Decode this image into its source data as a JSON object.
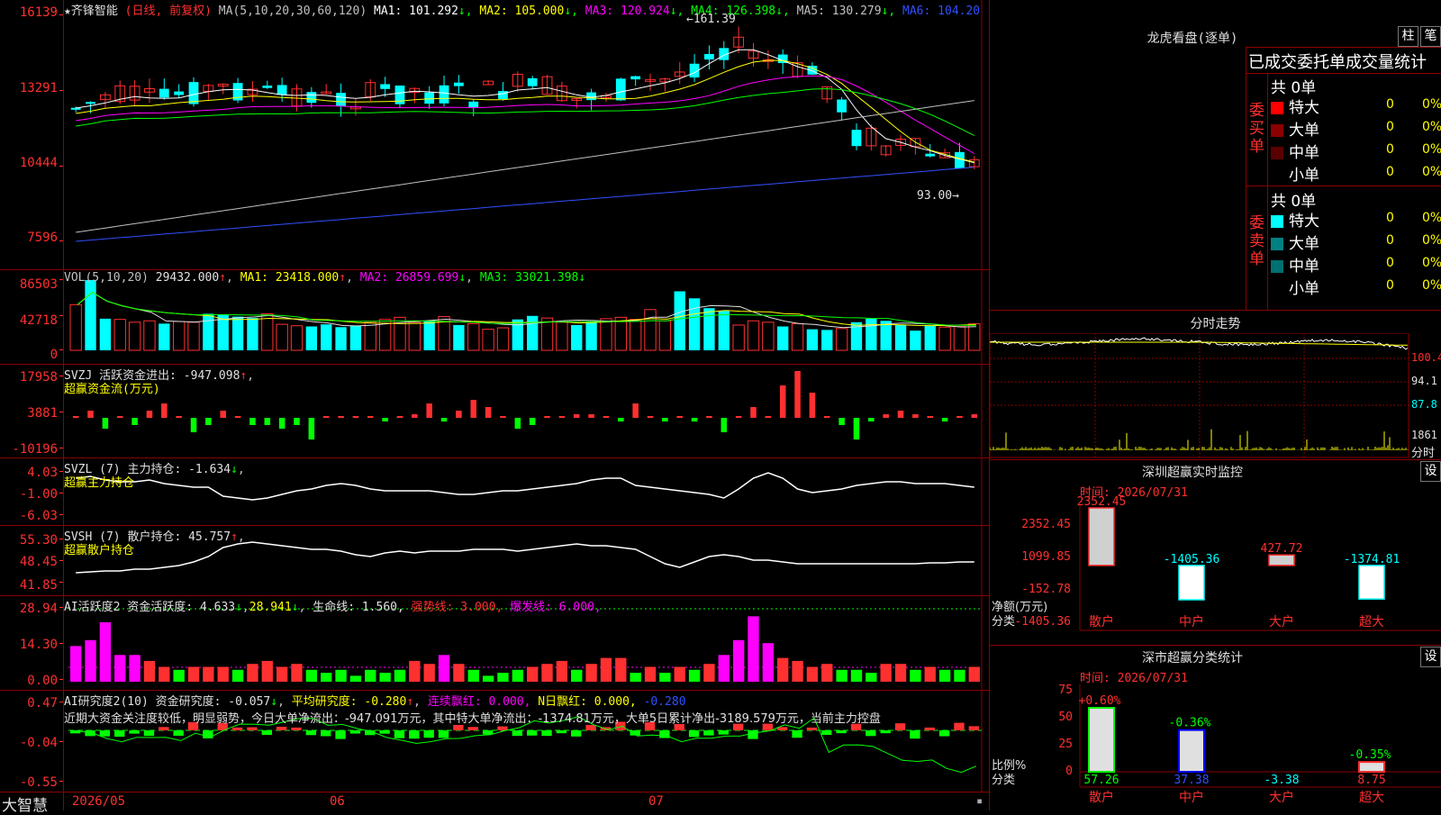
{
  "stock": {
    "name": "★齐锋智能",
    "mode": "(日线, 前复权)",
    "ma_label": "MA(5,10,20,30,60,120)",
    "ma": [
      {
        "text": "MA1: 101.292",
        "arrow": "↓",
        "color": "#ffffff"
      },
      {
        "text": "MA2: 105.000",
        "arrow": "↓",
        "color": "#ffff00"
      },
      {
        "text": "MA3: 120.924",
        "arrow": "↓",
        "color": "#ff00ff"
      },
      {
        "text": "MA4: 126.398",
        "arrow": "↓",
        "color": "#00ff00"
      },
      {
        "text": "MA5: 130.279",
        "arrow": "↓",
        "color": "#c0c0c0"
      },
      {
        "text": "MA6: 104.20",
        "arrow": "",
        "color": "#3050ff"
      }
    ],
    "y_labels": [
      "16139",
      "13291",
      "10444",
      "7596"
    ],
    "high_mark": "161.39",
    "low_mark": "93.00"
  },
  "colors": {
    "up": "#ff3030",
    "down": "#00ffff",
    "green": "#00ff00",
    "magenta": "#ff00ff",
    "grid": "#8b0000"
  },
  "vol": {
    "header": "VOL(5,10,20)",
    "value": "29432.000",
    "ma1": "MA1: 23418.000",
    "ma2": "MA2: 26859.699",
    "ma3": "MA3: 33021.398",
    "y_labels": [
      "86503",
      "42718",
      "0"
    ],
    "values": [
      65,
      100,
      45,
      44,
      40,
      42,
      38,
      41,
      40,
      52,
      51,
      48,
      46,
      52,
      37,
      35,
      34,
      37,
      33,
      35,
      40,
      44,
      47,
      40,
      42,
      48,
      36,
      38,
      30,
      32,
      44,
      49,
      46,
      40,
      36,
      41,
      45,
      47,
      44,
      58,
      42,
      84,
      74,
      60,
      56,
      36,
      42,
      40,
      34,
      38,
      30,
      29,
      31,
      40,
      45,
      42,
      36,
      28,
      35,
      33,
      34,
      38,
      38,
      36,
      29
    ]
  },
  "svzj": {
    "header": "SVZJ  活跃资金进出: -947.098",
    "sub": "超赢资金流(万元)",
    "y_labels": [
      "17958",
      "3881",
      "-10196"
    ],
    "values": [
      0,
      2,
      -3,
      0,
      -2,
      2,
      4,
      0,
      -4,
      -2,
      2,
      0,
      -2,
      -2,
      -3,
      -2,
      -6,
      0,
      0,
      0,
      0,
      -1,
      0,
      1,
      4,
      -1,
      2,
      5,
      3,
      0,
      -3,
      -2,
      0,
      0,
      1,
      1,
      0,
      -1,
      4,
      0,
      -1,
      0,
      -1,
      0,
      -4,
      0,
      3,
      0,
      9,
      13,
      7,
      0,
      -2,
      -6,
      -1,
      1,
      2,
      1,
      0,
      -1,
      0,
      1,
      0,
      1,
      -1,
      0,
      -1,
      0,
      0,
      0
    ]
  },
  "svzl": {
    "header": "SVZL (7) 主力持仓: -1.634",
    "sub": "超赢主力持仓",
    "y_labels": [
      "4.03",
      "-1.00",
      "-6.03"
    ]
  },
  "svsh": {
    "header": "SVSH (7) 散户持仓: 45.757",
    "sub": "超赢散户持仓",
    "y_labels": [
      "55.30",
      "48.45",
      "41.85"
    ]
  },
  "ai1": {
    "header": "AI活跃度2 资金活跃度: 4.633",
    "v2": "28.941",
    "life": "生命线: 1.560,",
    "strong": "强势线: 3.000,",
    "burst": "爆发线: 6.000,",
    "y_labels": [
      "28.94",
      "14.30",
      "0.00"
    ],
    "values": [
      12,
      14,
      20,
      9,
      9,
      7,
      5,
      4,
      5,
      5,
      5,
      4,
      6,
      7,
      5,
      6,
      4,
      3,
      4,
      2,
      4,
      3,
      4,
      7,
      6,
      9,
      6,
      4,
      2,
      3,
      4,
      5,
      6,
      7,
      4,
      6,
      8,
      8,
      3,
      5,
      3,
      5,
      4,
      6,
      9,
      14,
      22,
      13,
      8,
      7,
      5,
      6,
      4,
      4,
      3,
      6,
      6,
      4,
      5,
      4,
      4,
      5,
      6,
      3,
      3,
      2,
      2,
      3,
      4,
      4
    ]
  },
  "ai2": {
    "header": "AI研究度2(10) 资金研究度: -0.057",
    "avg": "平均研究度: -0.280",
    "cont": "连续飘红: 0.000,",
    "nday": "N日飘红: 0.000,",
    "tail": "-0.280",
    "comment": "近期大资金关注度较低，明显弱势，今日大单净流出：-947.091万元，其中特大单净流出：-1374.81万元，大单5日累计净出-3189.579万元，当前主力控盘",
    "y_labels": [
      "0.47",
      "-0.04",
      "-0.55"
    ]
  },
  "bottom": {
    "brand": "大智慧",
    "dates": [
      "2026/05",
      "06",
      "07"
    ]
  },
  "right": {
    "lhb_title": "龙虎看盘(逐单)",
    "btn_zhu": "柱",
    "btn_bi": "笔",
    "order_title": "已成交委托单成交量统计",
    "buy_label": "委买单",
    "sell_label": "委卖单",
    "buy_total": "共 0单",
    "sell_total": "共 0单",
    "buy_rows": [
      {
        "name": "特大",
        "count": "0",
        "pct": "0%",
        "color": "#ff0000"
      },
      {
        "name": "大单",
        "count": "0",
        "pct": "0%",
        "color": "#8b0000"
      },
      {
        "name": "中单",
        "count": "0",
        "pct": "0%",
        "color": "#5a0000"
      },
      {
        "name": "小单",
        "count": "0",
        "pct": "0%",
        "color": ""
      }
    ],
    "sell_rows": [
      {
        "name": "特大",
        "count": "0",
        "pct": "0%",
        "color": "#00ffff"
      },
      {
        "name": "大单",
        "count": "0",
        "pct": "0%",
        "color": "#008080"
      },
      {
        "name": "中单",
        "count": "0",
        "pct": "0%",
        "color": "#007070"
      },
      {
        "name": "小单",
        "count": "0",
        "pct": "0%",
        "color": ""
      }
    ],
    "intraday_title": "分时走势",
    "intraday_labels": [
      "100.4",
      "94.1",
      "87.8",
      "1861",
      "分时"
    ],
    "sz_title": "深圳超赢实时监控",
    "sz_time": "时间: 2026/07/31",
    "settings_btn": "设",
    "sz_y": [
      "2352.45",
      "1099.85",
      "-152.78",
      "-1405.36"
    ],
    "sz_axis_label": "净额(万元)",
    "sz_axis_label2": "分类",
    "sz_bars": [
      {
        "cat": "散户",
        "value": 2352.45,
        "label": "2352.45"
      },
      {
        "cat": "中户",
        "value": -1405.36,
        "label": "-1405.36"
      },
      {
        "cat": "大户",
        "value": 427.72,
        "label": "427.72"
      },
      {
        "cat": "超大",
        "value": -1374.81,
        "label": "-1374.81"
      }
    ],
    "sm_title": "深市超赢分类统计",
    "sm_time": "时间: 2026/07/31",
    "sm_y": [
      "75",
      "50",
      "25",
      "0"
    ],
    "sm_axis_label": "比例%",
    "sm_axis_label2": "分类",
    "sm_bars": [
      {
        "cat": "散户",
        "pct": 57.26,
        "change": "+0.60%",
        "label": "57.26"
      },
      {
        "cat": "中户",
        "pct": 37.38,
        "change": "-0.36%",
        "label": "37.38"
      },
      {
        "cat": "大户",
        "pct": -3.38,
        "change": "",
        "label": "-3.38"
      },
      {
        "cat": "超大",
        "pct": 8.75,
        "change": "-0.35%",
        "label": "8.75"
      }
    ]
  }
}
